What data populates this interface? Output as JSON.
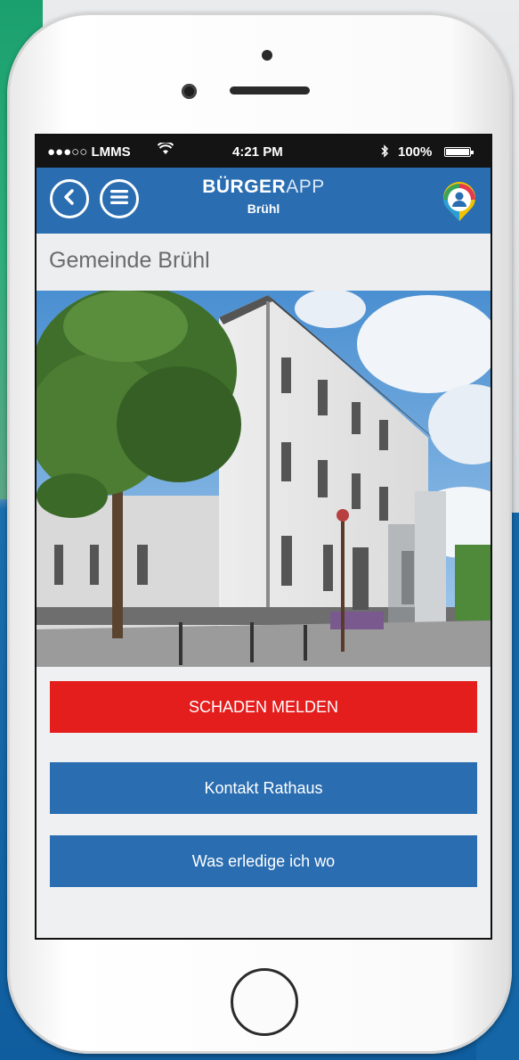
{
  "status_bar": {
    "carrier": "●●●○○ LMMS",
    "time": "4:21 PM",
    "battery": "100%"
  },
  "header": {
    "brand_bold": "BÜRGER",
    "brand_light": "APP",
    "city": "Brühl"
  },
  "page": {
    "title": "Gemeinde Brühl"
  },
  "buttons": {
    "report": "SCHADEN MELDEN",
    "contact": "Kontakt Rathaus",
    "where": "Was erledige ich wo"
  },
  "colors": {
    "header_blue": "#2a6db1",
    "report_red": "#e41d1d"
  },
  "icons": [
    "back-icon",
    "menu-icon",
    "profile-icon",
    "wifi-icon",
    "bluetooth-icon",
    "battery-icon"
  ]
}
